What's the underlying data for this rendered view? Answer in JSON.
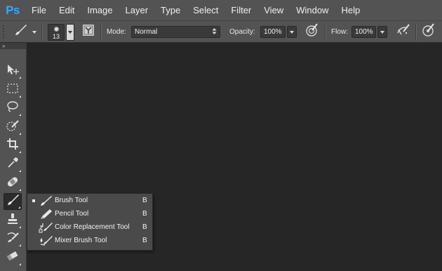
{
  "app": {
    "logo": "Ps"
  },
  "menu": [
    "File",
    "Edit",
    "Image",
    "Layer",
    "Type",
    "Select",
    "Filter",
    "View",
    "Window",
    "Help"
  ],
  "options": {
    "brush_size": "13",
    "mode_label": "Mode:",
    "mode_value": "Normal",
    "opacity_label": "Opacity:",
    "opacity_value": "100%",
    "flow_label": "Flow:",
    "flow_value": "100%"
  },
  "toolbar": {
    "collapse_glyph": "»",
    "tools": [
      {
        "name": "move-tool",
        "icon": "move-icon"
      },
      {
        "name": "marquee-tool",
        "icon": "marquee-icon"
      },
      {
        "name": "lasso-tool",
        "icon": "lasso-icon"
      },
      {
        "name": "quick-selection-tool",
        "icon": "quick-selection-icon"
      },
      {
        "name": "crop-tool",
        "icon": "crop-icon"
      },
      {
        "name": "eyedropper-tool",
        "icon": "eyedropper-icon"
      },
      {
        "name": "healing-brush-tool",
        "icon": "bandage-icon"
      },
      {
        "name": "brush-tool",
        "icon": "brush-icon",
        "active": true
      },
      {
        "name": "clone-stamp-tool",
        "icon": "stamp-icon"
      },
      {
        "name": "history-brush-tool",
        "icon": "history-brush-icon"
      },
      {
        "name": "eraser-tool",
        "icon": "eraser-icon"
      }
    ]
  },
  "flyout": {
    "items": [
      {
        "label": "Brush Tool",
        "shortcut": "B",
        "selected": true,
        "icon": "brush-icon"
      },
      {
        "label": "Pencil Tool",
        "shortcut": "B",
        "selected": false,
        "icon": "pencil-icon"
      },
      {
        "label": "Color Replacement Tool",
        "shortcut": "B",
        "selected": false,
        "icon": "color-replacement-icon"
      },
      {
        "label": "Mixer Brush Tool",
        "shortcut": "B",
        "selected": false,
        "icon": "mixer-brush-icon"
      }
    ]
  },
  "colors": {
    "canvas_bg": "#262626",
    "panel_bg": "#535353",
    "ps_logo": "#31a8ff"
  }
}
